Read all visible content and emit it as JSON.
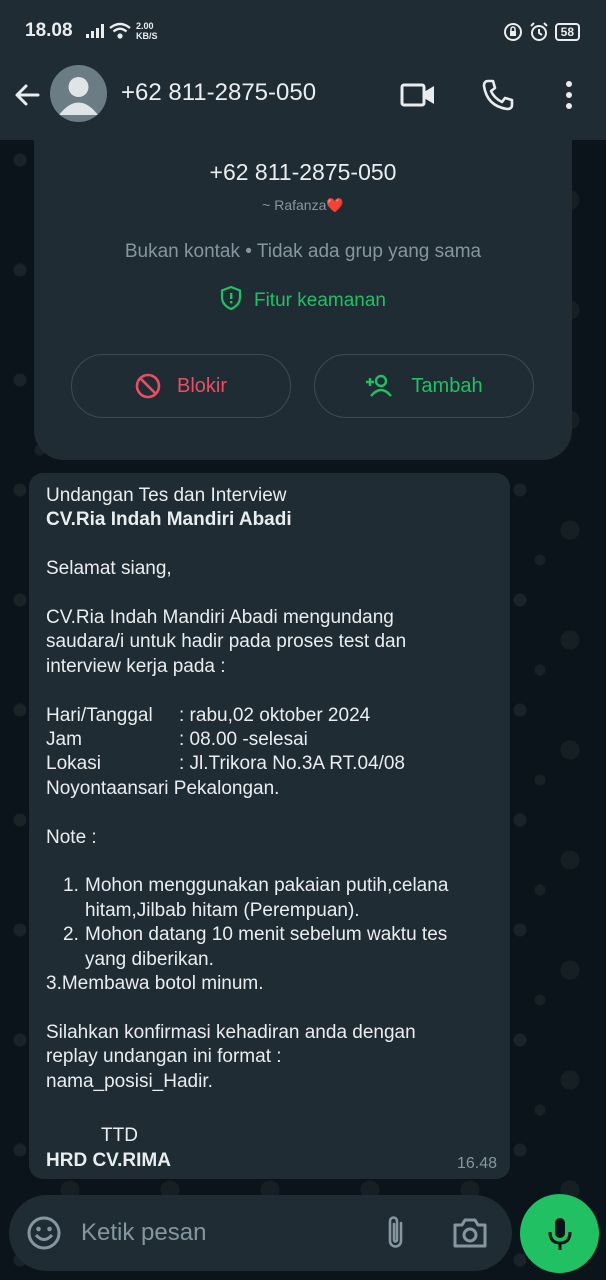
{
  "status_bar": {
    "time": "18.08",
    "net_speed_value": "2.00",
    "net_speed_unit": "KB/S",
    "battery": "58"
  },
  "header": {
    "title": "+62 811-2875-050",
    "icons": [
      "back-arrow-icon",
      "video-call-icon",
      "voice-call-icon",
      "more-options-icon"
    ]
  },
  "info_card": {
    "number": "+62 811-2875-050",
    "alias": "~ Rafanza❤️",
    "status": "Bukan kontak • Tidak ada grup yang sama",
    "security_label": "Fitur keamanan",
    "block_label": "Blokir",
    "add_label": "Tambah"
  },
  "message": {
    "title": "Undangan Tes dan Interview",
    "company": "CV.Ria Indah Mandiri Abadi",
    "greeting": "Selamat siang,",
    "intro_1": "CV.Ria Indah Mandiri Abadi mengundang",
    "intro_2": "saudara/i untuk hadir pada proses test dan",
    "intro_3": "interview kerja pada :",
    "rows": [
      {
        "label": "Hari/Tanggal",
        "value": ": rabu,02 oktober 2024"
      },
      {
        "label": "Jam",
        "value": ": 08.00 -selesai"
      },
      {
        "label": "Lokasi",
        "value": ": Jl.Trikora No.3A RT.04/08"
      }
    ],
    "location_line2": "Noyontaansari Pekalongan.",
    "note_title": "Note :",
    "note_items": [
      {
        "num": "1.",
        "line1": "Mohon menggunakan pakaian putih,celana",
        "line2": "hitam,Jilbab hitam (Perempuan)."
      },
      {
        "num": "2.",
        "line1": "Mohon datang 10 menit sebelum waktu tes",
        "line2": "yang diberikan."
      }
    ],
    "note_item3": "3.Membawa  botol minum.",
    "closing_1": "Silahkan konfirmasi kehadiran anda dengan",
    "closing_2": "replay undangan ini format :",
    "closing_3": "nama_posisi_Hadir.",
    "ttd": "TTD",
    "signature": "HRD CV.RIMA",
    "time": "16.48"
  },
  "input_bar": {
    "placeholder": "Ketik pesan"
  },
  "colors": {
    "accent": "#21c063",
    "danger": "#ea4e63",
    "bubble": "#1f2c34",
    "background": "#0b141a"
  }
}
